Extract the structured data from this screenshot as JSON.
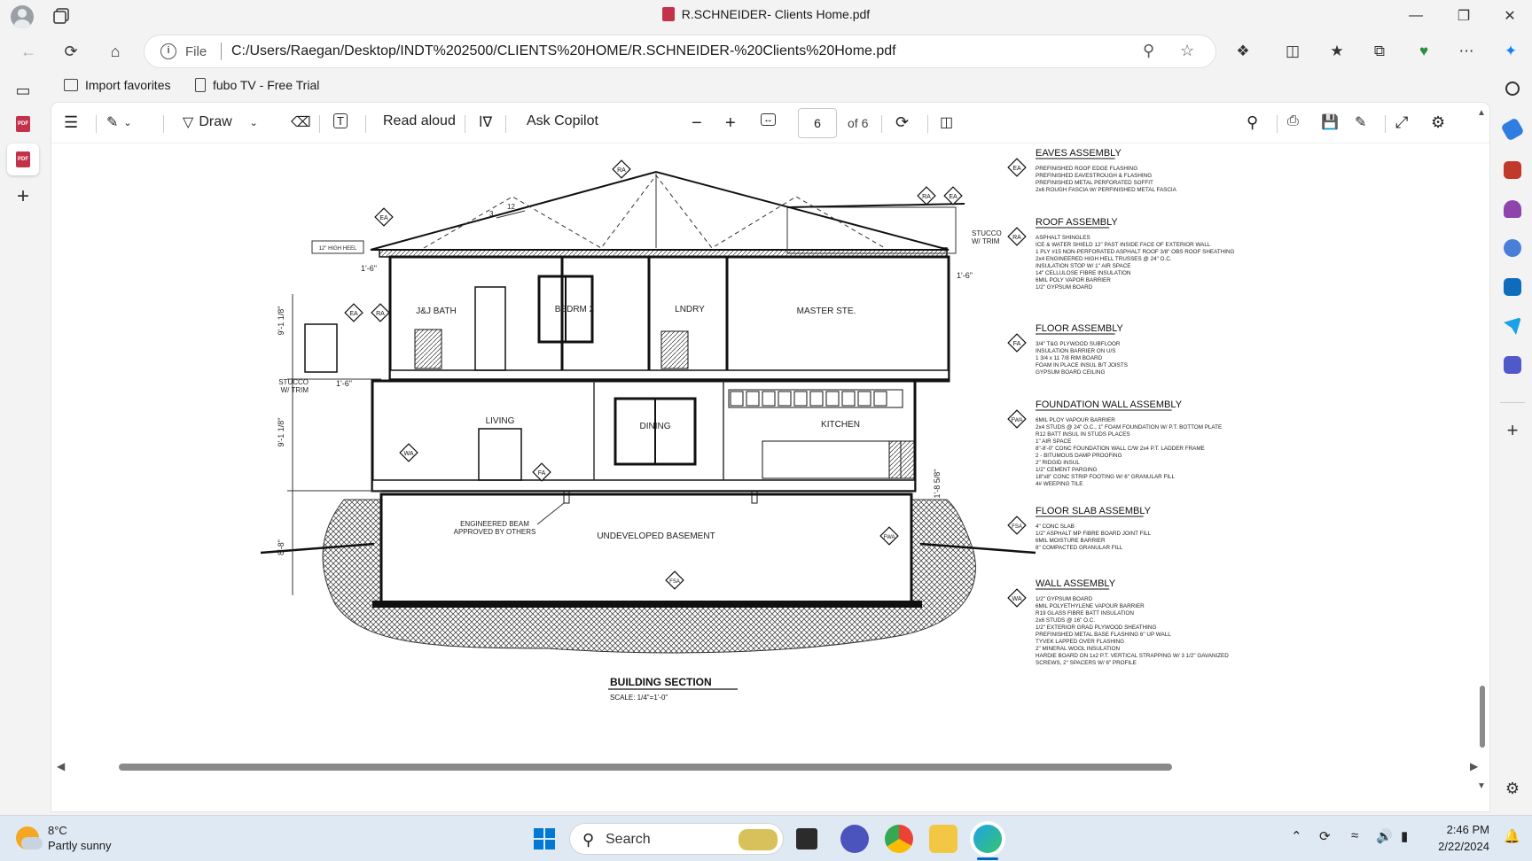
{
  "window": {
    "title": "R.SCHNEIDER- Clients Home.pdf",
    "minimize_icon": "minimize-icon",
    "maximize_icon": "restore-icon",
    "close_icon": "close-icon"
  },
  "address_bar": {
    "scheme_label": "File",
    "url": "C:/Users/Raegan/Desktop/INDT%202500/CLIENTS%20HOME/R.SCHNEIDER-%20Clients%20Home.pdf"
  },
  "favorites": {
    "items": [
      {
        "label": "Import favorites",
        "icon": "import-icon"
      },
      {
        "label": "fubo TV - Free Trial",
        "icon": "page-icon"
      }
    ]
  },
  "pdf_toolbar": {
    "draw_label": "Draw",
    "read_aloud_label": "Read aloud",
    "ask_copilot_label": "Ask Copilot",
    "current_page": "6",
    "page_of": "of 6"
  },
  "drawing": {
    "title": "BUILDING SECTION",
    "scale": "SCALE: 1/4\"=1'-0\"",
    "rooms": {
      "bath": "J&J BATH",
      "bedroom": "BEDRM 2",
      "laundry": "LNDRY",
      "master": "MASTER STE.",
      "living": "LIVING",
      "dining": "DINING",
      "kitchen": "KITCHEN",
      "basement": "UNDEVELOPED BASEMENT"
    },
    "notes": {
      "beam_line1": "ENGINEERED BEAM",
      "beam_line2": "APPROVED BY OTHERS",
      "stucco_right1": "STUCCO",
      "stucco_right2": "W/ TRIM",
      "stucco_left1": "STUCCO",
      "stucco_left2": "W/ TRIM",
      "heel": "12\" HIGH HEEL",
      "pitch_run": "12",
      "pitch_rise": "3"
    },
    "dims": {
      "overhang_left": "1'-6\"",
      "overhang_right": "1'-6\"",
      "overhang_mid": "1'-6\"",
      "upper_height": "9'-1 1/8\"",
      "main_height": "9'-1 1/8\"",
      "base_height": "8'-8\"",
      "grade": "1'-8 5/8\""
    },
    "tags": {
      "ra": "RA",
      "ea": "EA",
      "fa": "FA",
      "wa": "WA",
      "fwa": "FWA",
      "fsa": "FSA"
    },
    "assemblies": [
      {
        "tag": "EA",
        "title": "EAVES ASSEMBLY",
        "lines": [
          "PREFINISHED ROOF EDGE FLASHING",
          "PREFINISHED EAVESTROUGH & FLASHING",
          "PREFINISHED METAL PERFORATED SOFFIT",
          "2x6 ROUGH FASCIA W/ PERFINISHED METAL FASCIA"
        ]
      },
      {
        "tag": "RA",
        "title": "ROOF ASSEMBLY",
        "lines": [
          "ASPHALT SHINGLES",
          "ICE & WATER SHIELD 12\" PAST INSIDE FACE OF EXTERIOR WALL",
          "1 PLY #15 NON-PERFORATED ASPHALT ROOF 3/8\" OBS ROOF SHEATHING",
          "2x4 ENGINEERED HIGH HELL TRUSSES @ 24\" O.C.",
          "INSULATION STOP W/ 1\" AIR SPACE",
          "14\" CELLULOSE FIBRE INSULATION",
          "6MIL POLY VAPOR BARRIER",
          "1/2\" GYPSUM BOARD"
        ]
      },
      {
        "tag": "FA",
        "title": "FLOOR ASSEMBLY",
        "lines": [
          "3/4\" T&G PLYWOOD SUBFLOOR",
          "INSULATION BARRIER ON U/S",
          "1 3/4 x 11 7/8 RIM BOARD",
          "FOAM IN PLACE INSUL B/T JOISTS",
          "GYPSUM BOARD CEILING"
        ]
      },
      {
        "tag": "FWA",
        "title": "FOUNDATION WALL ASSEMBLY",
        "lines": [
          "6MIL PLOY VAPOUR BARRIER",
          "2x4 STUDS @ 24\" O.C., 1\" FOAM FOUNDATION W/ P.T. BOTTOM PLATE",
          "R12 BATT INSUL IN STUDS PLACES",
          "1\" AIR SPACE",
          "8\"-8'-0\" CONC FOUNDATION WALL C/W 2x4 P.T. LADDER FRAME",
          "2 - BITUMOUS DAMP PROOFING",
          "2\" RIDGID INSUL",
          "1/2\" CEMENT PARGING",
          "18\"x8\" CONC STRIP FOOTING W/ 6\" GRANULAR FILL",
          "4# WEEPING TILE"
        ]
      },
      {
        "tag": "FSA",
        "title": "FLOOR SLAB ASSEMBLY",
        "lines": [
          "4\" CONC SLAB",
          "1/2\" ASPHALT MP FIBRE BOARD JOINT FILL",
          "6MIL MOISTURE BARRIER",
          "8\" COMPACTED GRANULAR FILL"
        ]
      },
      {
        "tag": "WA",
        "title": "WALL ASSEMBLY",
        "lines": [
          "1/2\" GYPSUM BOARD",
          "6MIL POLYETHYLENE VAPOUR BARRIER",
          "R19 GLASS FIBRE BATT INSULATION",
          "2x6 STUDS @ 16\" O.C.",
          "1/2\" EXTERIOR GRAD PLYWOOD SHEATHING",
          "PREFINISHED METAL BASE FLASHING 6\" UP WALL",
          "TYVEK LAPPED OVER FLASHING",
          "2\" MINERAL WOOL INSULATION",
          "HARDIE BOARD ON 1x2 P.T. VERTICAL STRAPPING W/ 3 1/2\" GAVANIZED",
          "SCREWS, 2\" SPACERS W/ 6\" PROFILE"
        ]
      }
    ]
  },
  "taskbar": {
    "weather_temp": "8°C",
    "weather_desc": "Partly sunny",
    "search_label": "Search",
    "time": "2:46 PM",
    "date": "2/22/2024"
  },
  "colors": {
    "accent": "#0067c0",
    "pdf_red": "#c4314b",
    "taskbar_bg": "#dfe9f3"
  }
}
